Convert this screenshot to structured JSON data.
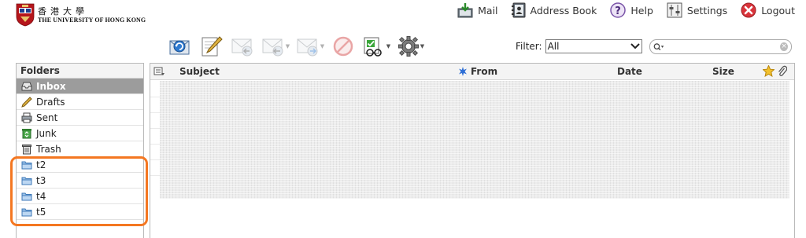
{
  "logo": {
    "cn": "香港大學",
    "en": "THE UNIVERSITY OF HONG KONG"
  },
  "topnav": {
    "mail": "Mail",
    "address_book": "Address Book",
    "help": "Help",
    "settings": "Settings",
    "logout": "Logout"
  },
  "toolbar": {
    "buttons": [
      "check-mail",
      "compose",
      "reply",
      "reply-all",
      "forward",
      "delete",
      "mark",
      "more-actions"
    ]
  },
  "filter": {
    "label": "Filter:",
    "value": "All"
  },
  "search": {
    "placeholder": "",
    "value": ""
  },
  "folders": {
    "title": "Folders",
    "items": [
      {
        "label": "Inbox",
        "icon": "inbox-icon",
        "selected": true
      },
      {
        "label": "Drafts",
        "icon": "pencil-icon"
      },
      {
        "label": "Sent",
        "icon": "printer-icon"
      },
      {
        "label": "Junk",
        "icon": "recycle-icon"
      },
      {
        "label": "Trash",
        "icon": "trash-icon"
      },
      {
        "label": "t2",
        "icon": "folder-icon"
      },
      {
        "label": "t3",
        "icon": "folder-icon"
      },
      {
        "label": "t4",
        "icon": "folder-icon"
      },
      {
        "label": "t5",
        "icon": "folder-icon"
      }
    ]
  },
  "messages": {
    "columns": {
      "subject": "Subject",
      "from": "From",
      "date": "Date",
      "size": "Size"
    }
  },
  "colors": {
    "highlight": "#f47721",
    "selected_folder": "#9c9c9c",
    "logout_icon": "#d9343b",
    "help_icon": "#7a54a8"
  }
}
